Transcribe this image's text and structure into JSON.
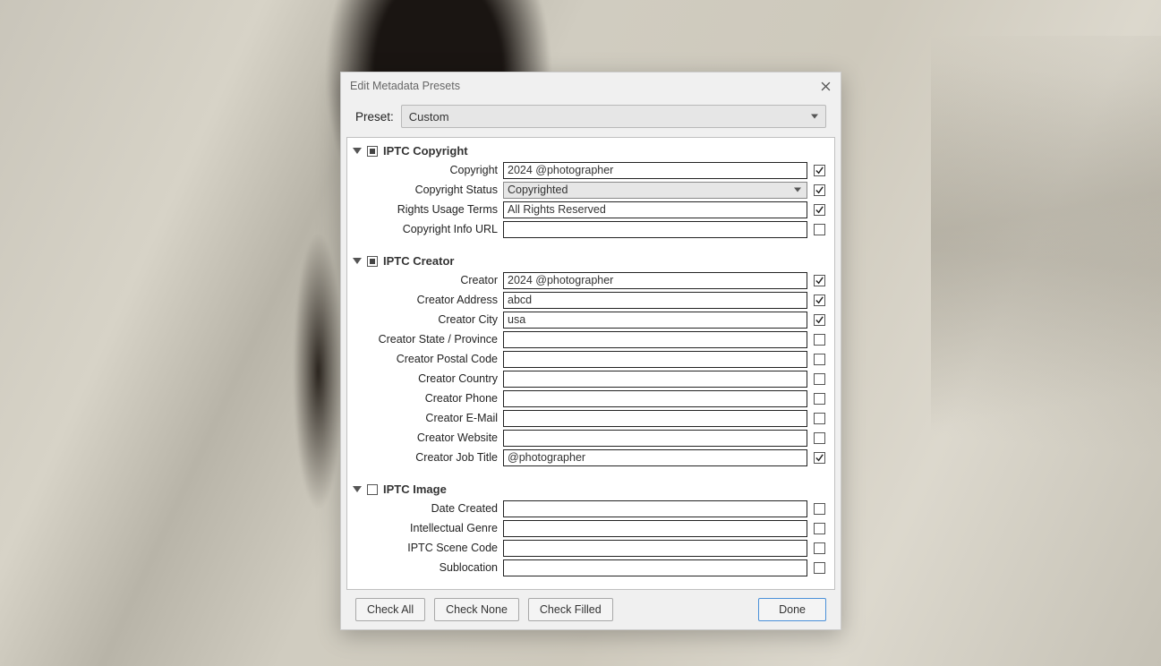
{
  "dialog": {
    "title": "Edit Metadata Presets",
    "preset_label": "Preset:",
    "preset_value": "Custom"
  },
  "sections": {
    "copyright": {
      "title": "IPTC Copyright",
      "state": "partial",
      "fields": [
        {
          "label": "Copyright",
          "value": "2024 @photographer",
          "checked": true,
          "type": "text"
        },
        {
          "label": "Copyright Status",
          "value": "Copyrighted",
          "checked": true,
          "type": "select"
        },
        {
          "label": "Rights Usage Terms",
          "value": "All Rights Reserved",
          "checked": true,
          "type": "text"
        },
        {
          "label": "Copyright Info URL",
          "value": "",
          "checked": false,
          "type": "text"
        }
      ]
    },
    "creator": {
      "title": "IPTC Creator",
      "state": "partial",
      "fields": [
        {
          "label": "Creator",
          "value": "2024 @photographer",
          "checked": true,
          "type": "text"
        },
        {
          "label": "Creator Address",
          "value": "abcd",
          "checked": true,
          "type": "text"
        },
        {
          "label": "Creator City",
          "value": "usa",
          "checked": true,
          "type": "text"
        },
        {
          "label": "Creator State / Province",
          "value": "",
          "checked": false,
          "type": "text"
        },
        {
          "label": "Creator Postal Code",
          "value": "",
          "checked": false,
          "type": "text"
        },
        {
          "label": "Creator Country",
          "value": "",
          "checked": false,
          "type": "text"
        },
        {
          "label": "Creator Phone",
          "value": "",
          "checked": false,
          "type": "text"
        },
        {
          "label": "Creator E-Mail",
          "value": "",
          "checked": false,
          "type": "text"
        },
        {
          "label": "Creator Website",
          "value": "",
          "checked": false,
          "type": "text"
        },
        {
          "label": "Creator Job Title",
          "value": "@photographer",
          "checked": true,
          "type": "text"
        }
      ]
    },
    "image": {
      "title": "IPTC Image",
      "state": "empty",
      "fields": [
        {
          "label": "Date Created",
          "value": "",
          "checked": false,
          "type": "text"
        },
        {
          "label": "Intellectual Genre",
          "value": "",
          "checked": false,
          "type": "text"
        },
        {
          "label": "IPTC Scene Code",
          "value": "",
          "checked": false,
          "type": "text"
        },
        {
          "label": "Sublocation",
          "value": "",
          "checked": false,
          "type": "text"
        }
      ]
    }
  },
  "footer": {
    "check_all": "Check All",
    "check_none": "Check None",
    "check_filled": "Check Filled",
    "done": "Done"
  }
}
